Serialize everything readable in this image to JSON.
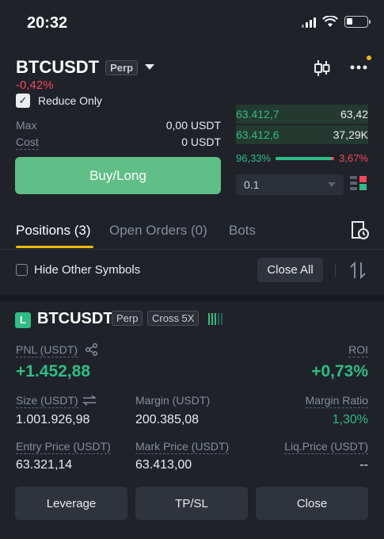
{
  "status_bar": {
    "time": "20:32",
    "battery_level": 0.3
  },
  "header": {
    "symbol": "BTCUSDT",
    "type_badge": "Perp",
    "change": "-0,42%",
    "icons": [
      "chevron-down-icon",
      "candlestick-chart-icon",
      "more-icon"
    ]
  },
  "order_form": {
    "reduce_only_label": "Reduce Only",
    "reduce_only_checked": true,
    "max_label": "Max",
    "max_value": "0,00 USDT",
    "cost_label": "Cost",
    "cost_value": "0 USDT",
    "buy_button": "Buy/Long"
  },
  "order_book": {
    "rows": [
      {
        "price": "63.412,7",
        "qty": "63,42"
      },
      {
        "price": "63.412,6",
        "qty": "37,29K"
      }
    ],
    "buy_ratio": "96,33%",
    "sell_ratio": "3,67%",
    "buy_ratio_value": 0.9633,
    "depth_value": "0.1"
  },
  "tabs": {
    "positions": "Positions (3)",
    "open_orders": "Open Orders (0)",
    "bots": "Bots"
  },
  "filters": {
    "hide_other_symbols": "Hide Other Symbols",
    "close_all": "Close All"
  },
  "position": {
    "side_badge": "L",
    "symbol": "BTCUSDT",
    "type_badge": "Perp",
    "margin_badge": "Cross 5X",
    "pnl_label": "PNL (USDT)",
    "pnl_value": "+1.452,88",
    "roi_label": "ROI",
    "roi_value": "+0,73%",
    "size_label": "Size (USDT)",
    "size_value": "1.001.926,98",
    "margin_label": "Margin (USDT)",
    "margin_value": "200.385,08",
    "margin_ratio_label": "Margin Ratio",
    "margin_ratio_value": "1,30%",
    "entry_label": "Entry Price (USDT)",
    "entry_value": "63.321,14",
    "mark_label": "Mark Price (USDT)",
    "mark_value": "63.413,00",
    "liq_label": "Liq.Price (USDT)",
    "liq_value": "--",
    "buttons": {
      "leverage": "Leverage",
      "tpsl": "TP/SL",
      "close": "Close"
    }
  },
  "colors": {
    "background": "#1f2229",
    "green": "#2ebd85",
    "buy_button": "#5fbf86",
    "red": "#f6465d",
    "accent": "#f0b90b"
  }
}
